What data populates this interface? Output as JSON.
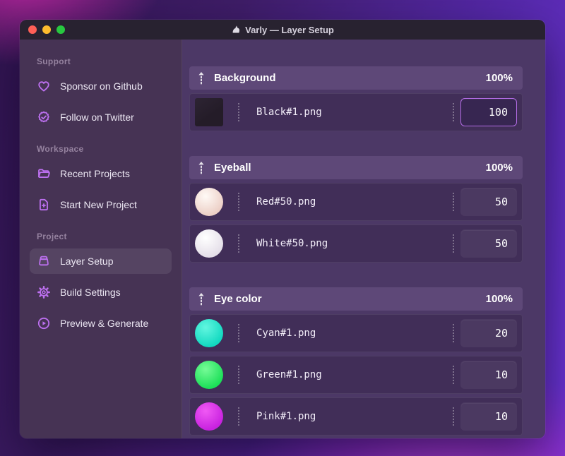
{
  "window": {
    "title": "Varly — Layer Setup",
    "traffic_lights": {
      "close": "#ff5f57",
      "minimize": "#febc2e",
      "zoom": "#28c840"
    }
  },
  "sidebar": {
    "sections": [
      {
        "label": "Support",
        "items": [
          {
            "label": "Sponsor on Github",
            "icon": "heart-icon"
          },
          {
            "label": "Follow on Twitter",
            "icon": "verified-badge-icon"
          }
        ]
      },
      {
        "label": "Workspace",
        "items": [
          {
            "label": "Recent Projects",
            "icon": "folder-icon"
          },
          {
            "label": "Start New Project",
            "icon": "file-plus-icon"
          }
        ]
      },
      {
        "label": "Project",
        "items": [
          {
            "label": "Layer Setup",
            "icon": "layer-box-icon",
            "active": true
          },
          {
            "label": "Build Settings",
            "icon": "gear-icon"
          },
          {
            "label": "Preview & Generate",
            "icon": "play-circle-icon"
          }
        ]
      }
    ]
  },
  "layers": {
    "groups": [
      {
        "name": "Background",
        "opacity": "100%",
        "rows": [
          {
            "filename": "Black#1.png",
            "weight": "100",
            "focused": true,
            "thumb": {
              "shape": "square",
              "base": "#241c28",
              "highlight": "#2d2433"
            }
          }
        ]
      },
      {
        "name": "Eyeball",
        "opacity": "100%",
        "rows": [
          {
            "filename": "Red#50.png",
            "weight": "50",
            "thumb": {
              "shape": "sphere",
              "base": "#eccfc6",
              "highlight": "#fffaf6"
            }
          },
          {
            "filename": "White#50.png",
            "weight": "50",
            "thumb": {
              "shape": "sphere",
              "base": "#e5dfe9",
              "highlight": "#ffffff"
            }
          }
        ]
      },
      {
        "name": "Eye color",
        "opacity": "100%",
        "rows": [
          {
            "filename": "Cyan#1.png",
            "weight": "20",
            "thumb": {
              "shape": "sphere",
              "base": "#12d9c0",
              "highlight": "#62f6e0"
            }
          },
          {
            "filename": "Green#1.png",
            "weight": "10",
            "thumb": {
              "shape": "sphere",
              "base": "#1cdf58",
              "highlight": "#76fb97"
            }
          },
          {
            "filename": "Pink#1.png",
            "weight": "10",
            "thumb": {
              "shape": "sphere",
              "base": "#c822df",
              "highlight": "#f059f4"
            }
          }
        ]
      }
    ]
  },
  "colors": {
    "accent": "#bd70f0",
    "focus_border": "#b36ce6",
    "header_bg": "#5e4878",
    "row_bg": "#412e58",
    "sidebar_bg": "#463354",
    "main_bg": "#4c3866",
    "titlebar_bg": "#282230"
  }
}
